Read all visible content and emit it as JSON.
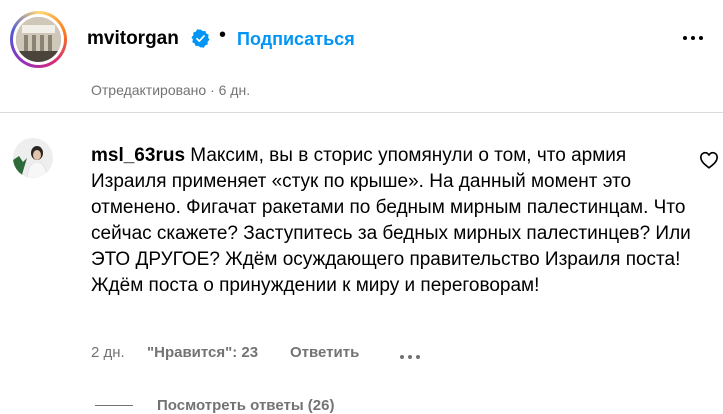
{
  "header": {
    "username": "mvitorgan",
    "separator": "•",
    "follow_label": "Подписаться",
    "edited_label": "Отредактировано · 6 дн."
  },
  "comment": {
    "username": "msl_63rus",
    "text": "Максим, вы в сторис упомянули о том, что армия Израиля применяет «стук по крыше». На данный момент это отменено. Фигачат ракетами по бедным мирным палестинцам. Что сейчас скажете? Заступитесь за бедных мирных палестинцев? Или ЭТО ДРУГОЕ? Ждём осуждающего правительство Израиля поста! Ждём поста о принуждении к миру и переговорам!",
    "time": "2 дн.",
    "likes": "\"Нравится\": 23",
    "reply_label": "Ответить",
    "view_replies": "Посмотреть ответы (26)"
  },
  "colors": {
    "accent": "#0095f6",
    "secondary_text": "#737373",
    "divider": "#dbdbdb"
  },
  "icons": {
    "verified": "verified-badge-icon",
    "more": "more-horizontal-icon",
    "like": "heart-outline-icon"
  }
}
